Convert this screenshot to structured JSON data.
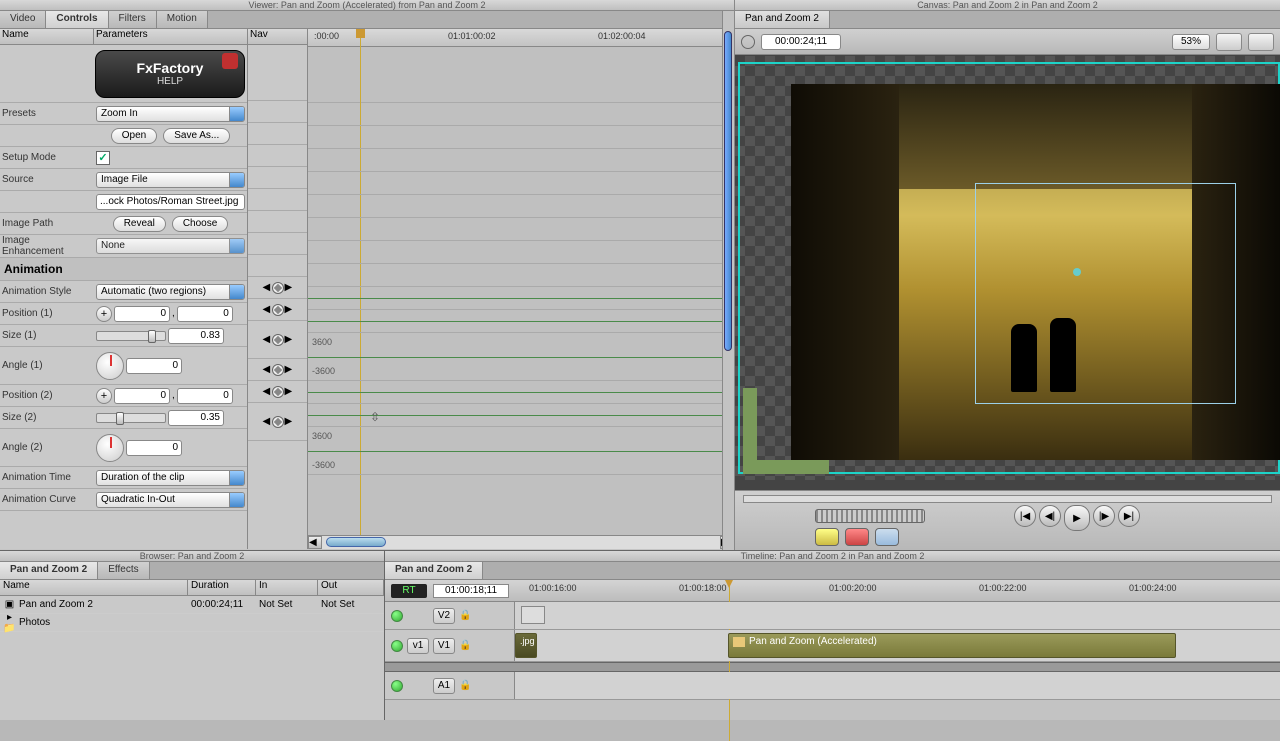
{
  "viewer": {
    "title": "Viewer: Pan and Zoom (Accelerated) from Pan and Zoom 2",
    "tabs": {
      "video": "Video",
      "controls": "Controls",
      "filters": "Filters",
      "motion": "Motion"
    },
    "cols": {
      "name": "Name",
      "parameters": "Parameters",
      "nav": "Nav"
    },
    "help": {
      "fx": "FxFactory",
      "label": "HELP"
    },
    "presets": {
      "label": "Presets",
      "value": "Zoom In",
      "open": "Open",
      "saveas": "Save As..."
    },
    "setup": {
      "label": "Setup Mode",
      "checked": true
    },
    "source": {
      "label": "Source",
      "value": "Image File"
    },
    "imgpath": {
      "label": "Image Path",
      "value": "...ock Photos/Roman Street.jpg",
      "reveal": "Reveal",
      "choose": "Choose"
    },
    "enh": {
      "label": "Image Enhancement",
      "value": "None"
    },
    "anim_hdr": "Animation",
    "astyle": {
      "label": "Animation Style",
      "value": "Automatic (two regions)"
    },
    "pos1": {
      "label": "Position (1)",
      "x": "0",
      "y": "0"
    },
    "size1": {
      "label": "Size (1)",
      "value": "0.83"
    },
    "ang1": {
      "label": "Angle (1)",
      "value": "0"
    },
    "pos2": {
      "label": "Position (2)",
      "x": "0",
      "y": "0"
    },
    "size2": {
      "label": "Size (2)",
      "value": "0.35"
    },
    "ang2": {
      "label": "Angle (2)",
      "value": "0"
    },
    "atime": {
      "label": "Animation Time",
      "value": "Duration of the clip"
    },
    "acurve": {
      "label": "Animation Curve",
      "value": "Quadratic In-Out"
    },
    "ruler": {
      "t0": ":00:00",
      "t1": "01:01:00:02",
      "t2": "01:02:00:04"
    },
    "scale": {
      "hi": "3600",
      "lo": "-3600"
    }
  },
  "canvas": {
    "title": "Canvas: Pan and Zoom 2 in Pan and Zoom 2",
    "tab": "Pan and Zoom 2",
    "timecode": "00:00:24;11",
    "zoom": "53%"
  },
  "browser": {
    "title": "Browser: Pan and Zoom 2",
    "tabs": {
      "proj": "Pan and Zoom 2",
      "fx": "Effects"
    },
    "cols": {
      "name": "Name",
      "dur": "Duration",
      "in": "In",
      "out": "Out"
    },
    "rows": [
      {
        "name": "Pan and Zoom 2",
        "dur": "00:00:24;11",
        "in": "Not Set",
        "out": "Not Set"
      },
      {
        "name": "Photos",
        "dur": "",
        "in": "",
        "out": ""
      }
    ]
  },
  "timeline": {
    "title": "Timeline: Pan and Zoom 2 in Pan and Zoom 2",
    "tab": "Pan and Zoom 2",
    "rt": "RT",
    "tc": "01:00:18;11",
    "ticks": [
      "01:00:16:00",
      "01:00:18:00",
      "01:00:20:00",
      "01:00:22:00",
      "01:00:24:00"
    ],
    "tracks": {
      "v2": "V2",
      "v1l": "v1",
      "v1": "V1",
      "a1": "A1"
    },
    "clip_jpg": ".jpg",
    "clip_main": "Pan and Zoom (Accelerated)"
  }
}
